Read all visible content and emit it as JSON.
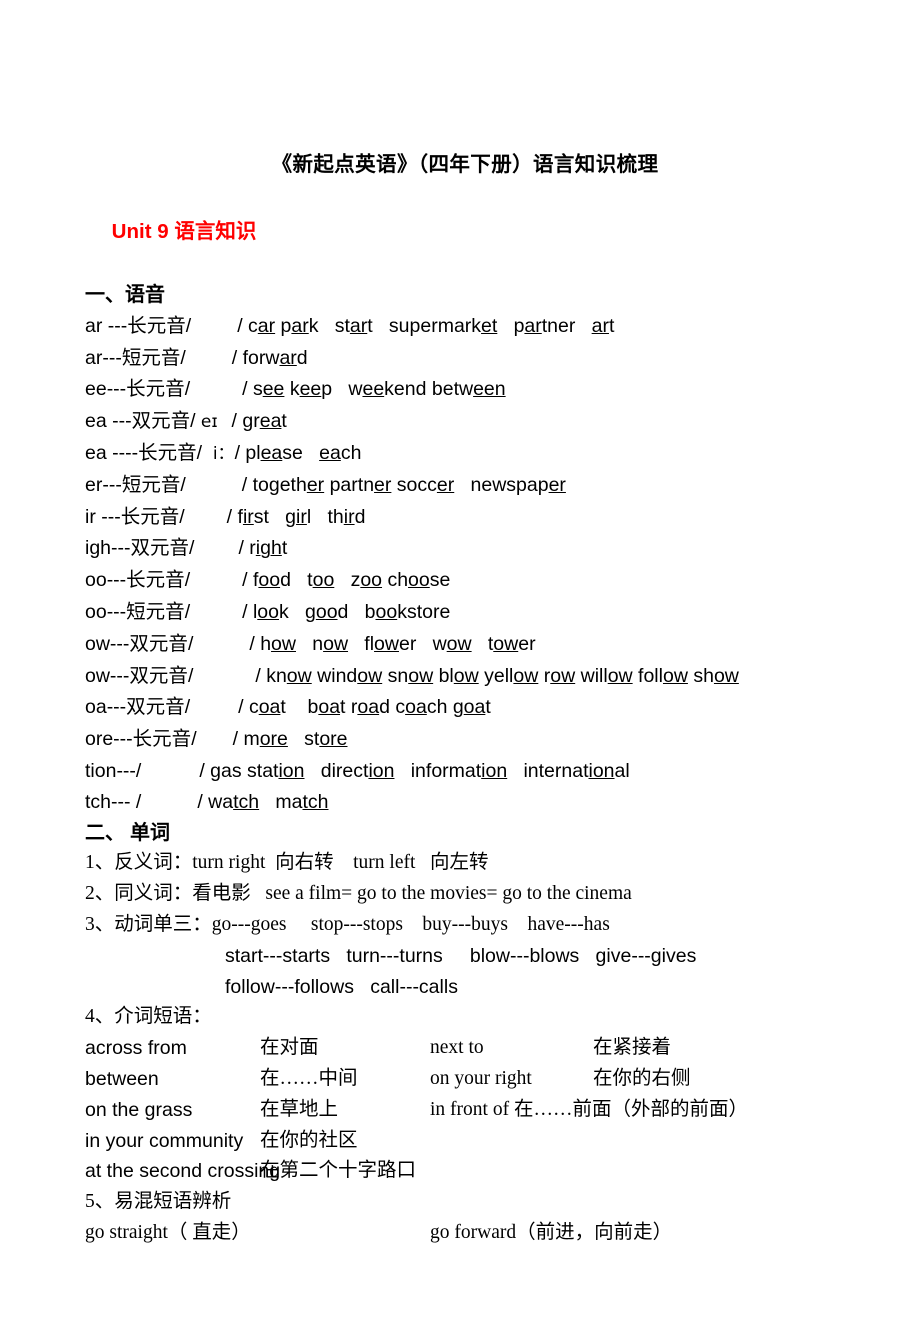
{
  "document": {
    "title": "《新起点英语》（四年下册）语言知识梳理",
    "unit_heading": {
      "en": "Unit 9 ",
      "cn": "语言知识",
      "color": "#FF0000"
    },
    "section_1_heading": "一、语音",
    "section_2_heading": "二、 单词"
  },
  "phonics": {
    "rows": [
      {
        "key_en": "ar ---",
        "key_cn": "长元音",
        "slash_open": "/",
        "ipa": "",
        "slash_close": "/ ",
        "words_html": "c<u class=\"mark\">ar</u> p<u class=\"mark\">ar</u>k   st<u class=\"mark\">ar</u>t   supermark<u class=\"mark\">et</u>   p<u class=\"mark\">ar</u>tner   <u class=\"mark\">ar</u>t",
        "words_plain": "car park   start   supermarket   partner   art",
        "gap": 46
      },
      {
        "key_en": "ar---",
        "key_cn": "短元音",
        "slash_open": "/",
        "ipa": "",
        "slash_close": "/ ",
        "words_html": "forw<u class=\"mark\">ar</u>d",
        "words_plain": "forward",
        "gap": 46
      },
      {
        "key_en": "ee---",
        "key_cn": "长元音",
        "slash_open": "/",
        "ipa": "",
        "slash_close": "/ ",
        "words_html": "s<u class=\"mark\">ee</u> k<u class=\"mark\">ee</u>p   w<u class=\"mark\">ee</u>kend betw<u class=\"mark\">een</u>",
        "words_plain": "see keep   weekend between",
        "gap": 52
      },
      {
        "key_en": "ea ---",
        "key_cn": "双元音",
        "slash_open": "/",
        "ipa": " eɪ",
        "slash_close": "/ ",
        "words_html": "gr<u class=\"mark\">ea</u>t",
        "words_plain": "great",
        "gap": 36
      },
      {
        "key_en": "ea ----",
        "key_cn": "长元音",
        "slash_open": "/",
        "ipa": "  i：",
        "slash_close": "/ ",
        "words_html": "pl<u class=\"mark\">ea</u>se   <u class=\"mark\">ea</u>ch",
        "words_plain": "please   each",
        "gap": 6
      },
      {
        "key_en": "er---",
        "key_cn": "短元音",
        "slash_open": "/",
        "ipa": "",
        "slash_close": "/ ",
        "words_html": "togeth<u class=\"mark\">er</u> partn<u class=\"mark\">er</u> socc<u class=\"mark\">er</u>   newspap<u class=\"mark\">er</u>",
        "words_plain": "together partner soccer   newspaper",
        "gap": 56
      },
      {
        "key_en": "ir ---",
        "key_cn": "长元音",
        "slash_open": "/",
        "ipa": "",
        "slash_close": "/ ",
        "words_html": "f<u class=\"mark\">ir</u>st   g<u class=\"mark\">ir</u>l   th<u class=\"mark\">ir</u>d",
        "words_plain": "first   girl   third",
        "gap": 42
      },
      {
        "key_en": "igh---",
        "key_cn": "双元音",
        "slash_open": "/",
        "ipa": "",
        "slash_close": "/ ",
        "words_html": "r<u class=\"mark\">igh</u>t",
        "words_plain": "right",
        "gap": 44
      },
      {
        "key_en": "oo---",
        "key_cn": "长元音",
        "slash_open": "/",
        "ipa": "",
        "slash_close": "/ ",
        "words_html": "f<u class=\"mark\">oo</u>d   t<u class=\"mark\">oo</u>   z<u class=\"mark\">oo</u> ch<u class=\"mark\">oo</u>se",
        "words_plain": "food   too   zoo choose",
        "gap": 52
      },
      {
        "key_en": "oo---",
        "key_cn": "短元音",
        "slash_open": "/",
        "ipa": "",
        "slash_close": "/ ",
        "words_html": "l<u class=\"mark\">oo</u>k   g<u class=\"mark\">oo</u>d   b<u class=\"mark\">oo</u>kstore",
        "words_plain": "look   good   bookstore",
        "gap": 52
      },
      {
        "key_en": "ow---",
        "key_cn": "双元音",
        "slash_open": "/",
        "ipa": "",
        "slash_close": "/ ",
        "words_html": "h<u class=\"mark\">ow</u>   n<u class=\"mark\">ow</u>   fl<u class=\"mark\">ow</u>er   w<u class=\"mark\">ow</u>   t<u class=\"mark\">ow</u>er",
        "words_plain": "how   now   flower   wow   tower",
        "gap": 56
      },
      {
        "key_en": "ow---",
        "key_cn": "双元音",
        "slash_open": "/",
        "ipa": "",
        "slash_close": "/ ",
        "words_html": "kn<u class=\"mark\">ow</u> wind<u class=\"mark\">ow</u> sn<u class=\"mark\">ow</u> bl<u class=\"mark\">ow</u> yell<u class=\"mark\">ow</u> r<u class=\"mark\">ow</u> will<u class=\"mark\">ow</u> foll<u class=\"mark\">ow</u> sh<u class=\"mark\">ow</u>",
        "words_plain": "know window snow blow yellow row willow follow show",
        "gap": 62
      },
      {
        "key_en": "oa---",
        "key_cn": "双元音",
        "slash_open": "/",
        "ipa": "",
        "slash_close": "/ ",
        "words_html": "c<u class=\"mark\">oa</u>t    b<u class=\"mark\">oa</u>t r<u class=\"mark\">oa</u>d c<u class=\"mark\">oa</u>ch g<u class=\"mark\">oa</u>t",
        "words_plain": "coat    boat road coach goat",
        "gap": 48
      },
      {
        "key_en": "ore---",
        "key_cn": "长元音",
        "slash_open": "/",
        "ipa": "",
        "slash_close": "/ ",
        "words_html": "m<u class=\"mark\">ore</u>   st<u class=\"mark\">ore</u>",
        "words_plain": "more   store",
        "gap": 36
      },
      {
        "key_en": "tion---",
        "key_cn": "",
        "slash_open": "/",
        "ipa": "",
        "slash_close": "/ ",
        "words_html": "gas stat<u class=\"mark\">ion</u>   direct<u class=\"mark\">ion</u>   informat<u class=\"mark\">ion</u>   internat<u class=\"mark\">ion</u>al",
        "words_plain": "gas station   direction   information   international",
        "gap": 58
      },
      {
        "key_en": "tch--- ",
        "key_cn": "",
        "slash_open": "/",
        "ipa": "",
        "slash_close": "/ ",
        "words_html": "wa<u class=\"mark\">tch</u>   ma<u class=\"mark\">tch</u>",
        "words_plain": "watch   match",
        "gap": 56
      }
    ]
  },
  "vocabulary": {
    "item_1": "1、反义词：turn right  向右转    turn left   向左转",
    "item_2": "2、同义词：看电影   see a film= go to the movies= go to the cinema",
    "item_3": "3、动词单三：go---goes     stop---stops    buy---buys    have---has",
    "item_3_cont_1": "start---starts   turn---turns     blow---blows   give---gives",
    "item_3_cont_2": "follow---follows   call---calls",
    "item_4_label": "4、介词短语：",
    "prepositions": [
      {
        "en_left": "across from",
        "cn_left": "在对面",
        "en_right": "next to",
        "cn_right": "在紧接着"
      },
      {
        "en_left": "between",
        "cn_left": "在……中间",
        "en_right": "on your right",
        "cn_right": "在你的右侧"
      },
      {
        "en_left": "on the grass",
        "cn_left": "在草地上",
        "en_right": "in front of 在……前面（外部的前面）",
        "cn_right": ""
      },
      {
        "en_left": "in your community",
        "cn_left": "在你的社区",
        "en_right": "",
        "cn_right": ""
      },
      {
        "en_left": "at the second crossing",
        "cn_left": "在第二个十字路口",
        "en_right": "",
        "cn_right": ""
      }
    ],
    "item_5_label": "5、易混短语辨析",
    "confusables": {
      "left": "go straight（ 直走）",
      "right": "go forward（前进，向前走）"
    }
  }
}
